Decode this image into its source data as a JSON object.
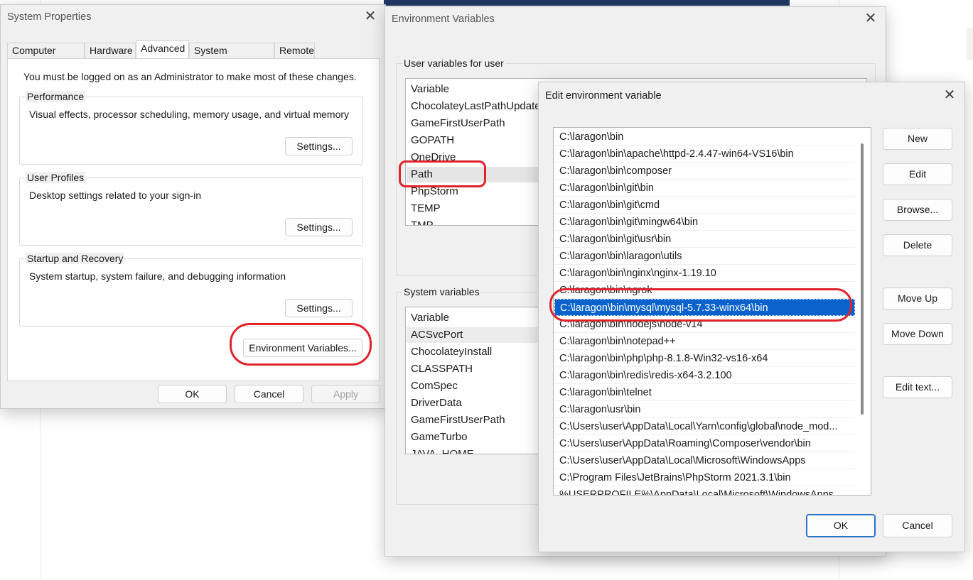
{
  "system_properties": {
    "title": "System Properties",
    "tabs": [
      "Computer Name",
      "Hardware",
      "Advanced",
      "System Protection",
      "Remote"
    ],
    "active_tab": "Advanced",
    "admin_note": "You must be logged on as an Administrator to make most of these changes.",
    "performance": {
      "label": "Performance",
      "desc": "Visual effects, processor scheduling, memory usage, and virtual memory",
      "button": "Settings..."
    },
    "user_profiles": {
      "label": "User Profiles",
      "desc": "Desktop settings related to your sign-in",
      "button": "Settings..."
    },
    "startup_recovery": {
      "label": "Startup and Recovery",
      "desc": "System startup, system failure, and debugging information",
      "button": "Settings..."
    },
    "env_vars_button": "Environment Variables...",
    "ok": "OK",
    "cancel": "Cancel",
    "apply": "Apply"
  },
  "environment_variables": {
    "title": "Environment Variables",
    "user_group_label": "User variables for user",
    "user_header": "Variable",
    "user_vars": [
      "ChocolateyLastPathUpdate",
      "GameFirstUserPath",
      "GOPATH",
      "OneDrive",
      "Path",
      "PhpStorm",
      "TEMP",
      "TMP"
    ],
    "system_group_label": "System variables",
    "system_header": "Variable",
    "system_vars": [
      "ACSvcPort",
      "ChocolateyInstall",
      "CLASSPATH",
      "ComSpec",
      "DriverData",
      "GameFirstUserPath",
      "GameTurbo",
      "JAVA_HOME"
    ]
  },
  "edit_env_var": {
    "title": "Edit environment variable",
    "paths": [
      "C:\\laragon\\bin",
      "C:\\laragon\\bin\\apache\\httpd-2.4.47-win64-VS16\\bin",
      "C:\\laragon\\bin\\composer",
      "C:\\laragon\\bin\\git\\bin",
      "C:\\laragon\\bin\\git\\cmd",
      "C:\\laragon\\bin\\git\\mingw64\\bin",
      "C:\\laragon\\bin\\git\\usr\\bin",
      "C:\\laragon\\bin\\laragon\\utils",
      "C:\\laragon\\bin\\nginx\\nginx-1.19.10",
      "C:\\laragon\\bin\\ngrok",
      "C:\\laragon\\bin\\mysql\\mysql-5.7.33-winx64\\bin",
      "C:\\laragon\\bin\\nodejs\\node-v14",
      "C:\\laragon\\bin\\notepad++",
      "C:\\laragon\\bin\\php\\php-8.1.8-Win32-vs16-x64",
      "C:\\laragon\\bin\\redis\\redis-x64-3.2.100",
      "C:\\laragon\\bin\\telnet",
      "C:\\laragon\\usr\\bin",
      "C:\\Users\\user\\AppData\\Local\\Yarn\\config\\global\\node_mod...",
      "C:\\Users\\user\\AppData\\Roaming\\Composer\\vendor\\bin",
      "C:\\Users\\user\\AppData\\Local\\Microsoft\\WindowsApps",
      "C:\\Program Files\\JetBrains\\PhpStorm 2021.3.1\\bin",
      "%USERPROFILE%\\AppData\\Local\\Microsoft\\WindowsApps"
    ],
    "selected_index": 10,
    "buttons": {
      "new": "New",
      "edit": "Edit",
      "browse": "Browse...",
      "delete": "Delete",
      "move_up": "Move Up",
      "move_down": "Move Down",
      "edit_text": "Edit text..."
    },
    "ok": "OK",
    "cancel": "Cancel"
  },
  "icons": {
    "close": "close-icon"
  },
  "colors": {
    "selection": "#0a63cc",
    "highlight_mark": "#e0232b",
    "dialog_bg": "#f0f0f0"
  }
}
